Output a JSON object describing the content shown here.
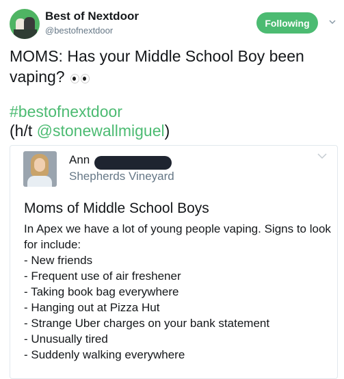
{
  "tweet": {
    "display_name": "Best of Nextdoor",
    "handle": "@bestofnextdoor",
    "follow_label": "Following",
    "text": "MOMS: Has your Middle School Boy been vaping?",
    "emoji_icon": "eyes-icon",
    "hashtag": "#bestofnextdoor",
    "ht_prefix": "(h/t ",
    "ht_mention": "@stonewallmiguel",
    "ht_suffix": ")"
  },
  "card": {
    "author_name": "Ann",
    "neighborhood": "Shepherds Vineyard",
    "post_title": "Moms of Middle School Boys",
    "post_intro": "In Apex we have a lot of young people vaping.  Signs to look for include:",
    "signs": [
      "- New friends",
      "- Frequent use of air freshener",
      "- Taking book bag everywhere",
      "- Hanging out at Pizza Hut",
      "- Strange Uber charges on your bank statement",
      "- Unusually tired",
      "- Suddenly walking everywhere"
    ]
  },
  "colors": {
    "accent": "#4cbb72",
    "muted": "#657786",
    "text": "#14171a"
  }
}
